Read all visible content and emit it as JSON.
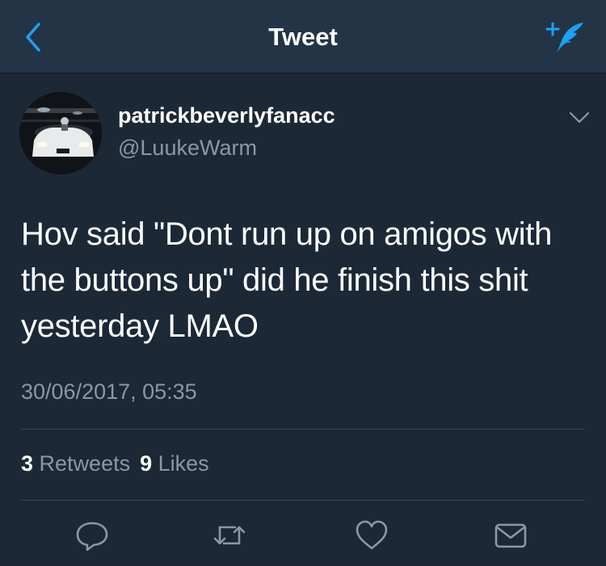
{
  "header": {
    "title": "Tweet",
    "back_icon": "chevron-left-icon",
    "compose_icon": "compose-tweet-icon",
    "accent_color": "#1da1f2"
  },
  "tweet": {
    "author": {
      "display_name": "patrickbeverlyfanacc",
      "handle": "@LuukeWarm"
    },
    "text": "Hov said \"Dont run up on amigos with the buttons up\" did he finish this shit yesterday LMAO",
    "timestamp": "30/06/2017, 05:35",
    "stats": {
      "retweets_count": "3",
      "retweets_label": "Retweets",
      "likes_count": "9",
      "likes_label": "Likes"
    },
    "actions": [
      "reply-icon",
      "retweet-icon",
      "like-icon",
      "direct-message-icon"
    ]
  },
  "colors": {
    "background": "#1c2836",
    "navbar": "#243447",
    "secondary_text": "#8899a6",
    "divider": "#38444d"
  }
}
